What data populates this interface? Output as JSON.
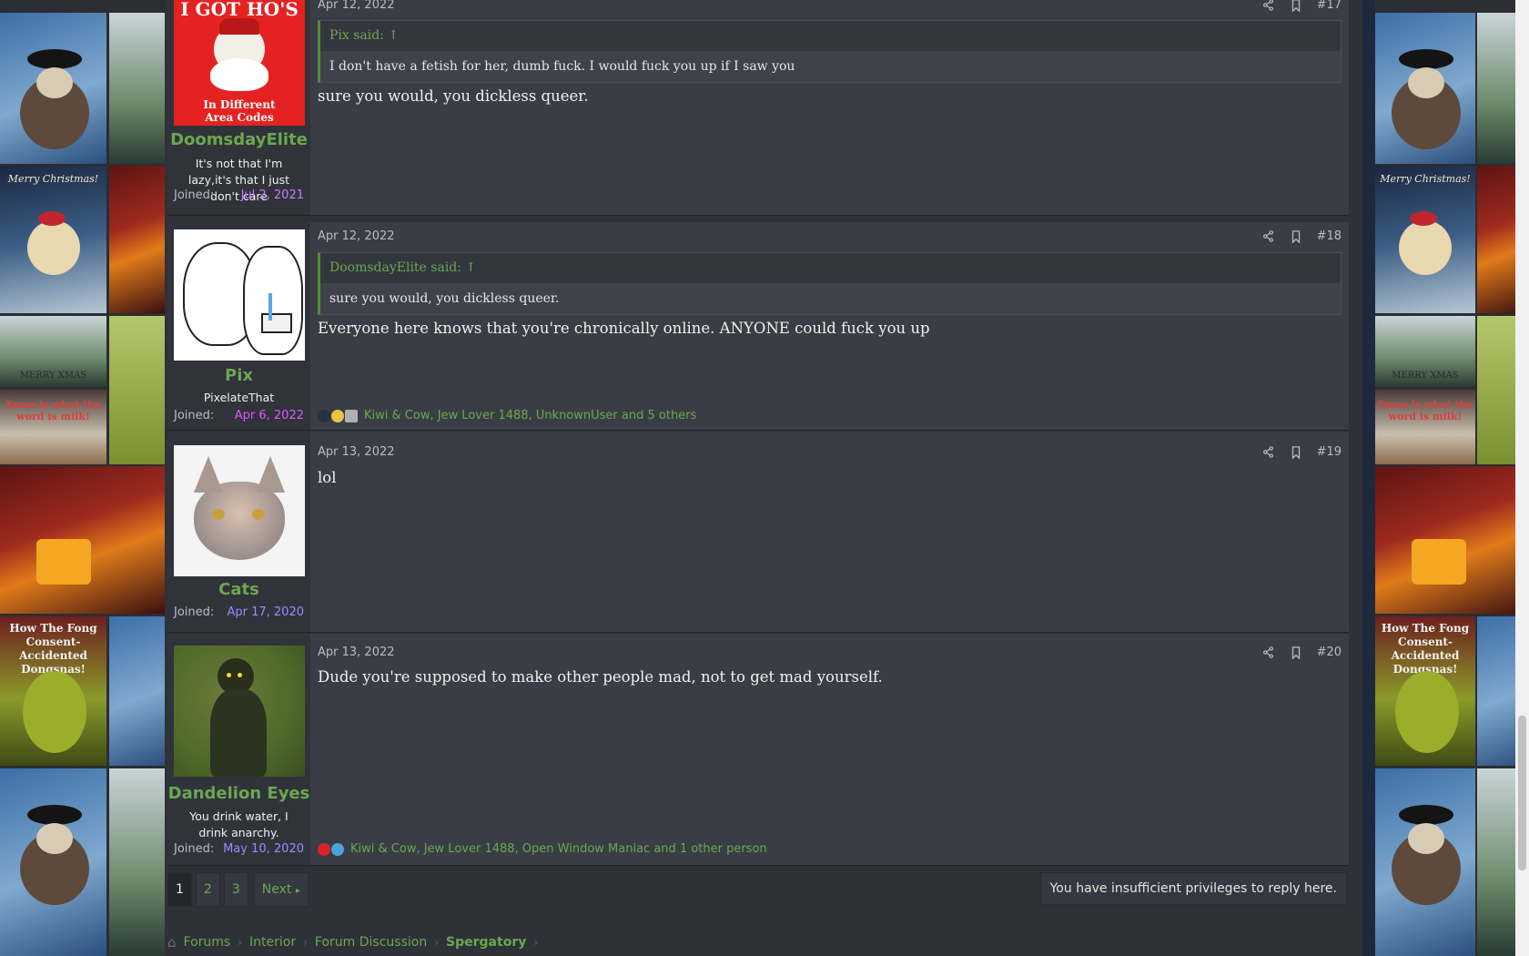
{
  "posts": [
    {
      "username": "DoomsdayElite",
      "user_title": "It's not that I'm lazy,it's that I just don't care",
      "joined_label": "Joined:",
      "joined_date": "Jul 2, 2021",
      "joined_color": "#c77dff",
      "date": "Apr 12, 2022",
      "number": "#17",
      "avatar_text": [
        "I GOT HO'S",
        "In Different",
        "Area Codes"
      ],
      "quote_author": "Pix said:",
      "quote_text": "I don't have a fetish for her, dumb fuck. I would fuck you up if I saw you",
      "message": "sure you would, you dickless queer."
    },
    {
      "username": "Pix",
      "user_title": "PixelateThat",
      "joined_label": "Joined:",
      "joined_date": "Apr 6, 2022",
      "joined_color": "#e056fd",
      "date": "Apr 12, 2022",
      "number": "#18",
      "quote_author": "DoomsdayElite said:",
      "quote_text": "sure you would, you dickless queer.",
      "message": "Everyone here knows that you're chronically online. ANYONE could fuck you up",
      "reactions": "Kiwi & Cow, Jew Lover 1488, UnknownUser and 5 others"
    },
    {
      "username": "Cats",
      "joined_label": "Joined:",
      "joined_date": "Apr 17, 2020",
      "joined_color": "#9b8cff",
      "date": "Apr 13, 2022",
      "number": "#19",
      "message": "lol"
    },
    {
      "username": "Dandelion Eyes",
      "user_title": "You drink water, I drink anarchy.",
      "joined_label": "Joined:",
      "joined_date": "May 10, 2020",
      "joined_color": "#9b8cff",
      "date": "Apr 13, 2022",
      "number": "#20",
      "message": "Dude you're supposed to make other people mad, not to get mad yourself.",
      "reactions": "Kiwi & Cow, Jew Lover 1488, Open Window Maniac and 1 other person"
    }
  ],
  "wallpaper_captions": {
    "merry_christmas": "Merry Christmas!",
    "merry_xmas": "MERRY XMAS",
    "xmas_milk": "Xmas is what the word is milk!",
    "grinch": "How The Fong Consent-Accidented Dongsnas!"
  },
  "pager": {
    "pages": [
      "1",
      "2",
      "3"
    ],
    "current": "1",
    "next_label": "Next"
  },
  "no_reply": "You have insufficient privileges to reply here.",
  "breadcrumbs": [
    "Forums",
    "Interior",
    "Forum Discussion",
    "Spergatory"
  ],
  "icons": {
    "share": "share-icon",
    "bookmark": "bookmark-icon",
    "home": "home-icon",
    "quote_up": "arrow-up-circle-icon"
  }
}
